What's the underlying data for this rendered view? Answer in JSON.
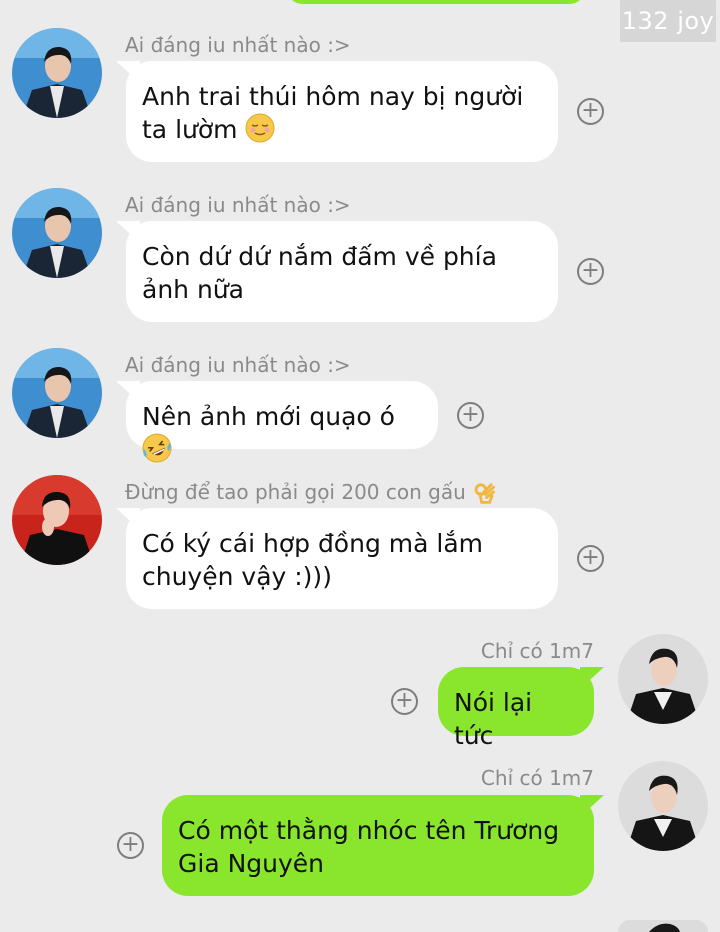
{
  "watermark": "132 joy",
  "messages": [
    {
      "sender": "Ai đáng iu nhất nào :>",
      "text": "Anh trai thúi hôm nay bị người ta lườm",
      "emoji": "relieved-face-emoji",
      "direction": "incoming"
    },
    {
      "sender": "Ai đáng iu nhất nào :>",
      "text": "Còn dứ dứ nắm đấm về phía ảnh nữa",
      "direction": "incoming"
    },
    {
      "sender": "Ai đáng iu nhất nào :>",
      "text": "Nên ảnh mới quạo ó",
      "emoji": "rolling-laughing-emoji",
      "direction": "incoming"
    },
    {
      "sender": "Đừng để tao phải gọi 200 con gấu",
      "sender_emoji": "ok-hand-emoji",
      "text": "Có ký cái hợp đồng mà lắm chuyện vậy :)))",
      "direction": "incoming"
    },
    {
      "sender": "Chỉ có 1m7",
      "text": "Nói lại tức",
      "direction": "outgoing"
    },
    {
      "sender": "Chỉ có 1m7",
      "text": "Có một thằng nhóc tên Trương Gia Nguyên",
      "direction": "outgoing"
    }
  ],
  "plus_symbol": "+",
  "colors": {
    "background": "#ebebeb",
    "incoming_bubble": "#ffffff",
    "outgoing_bubble": "#8ae62c",
    "sender_text": "#8a8a8a"
  }
}
